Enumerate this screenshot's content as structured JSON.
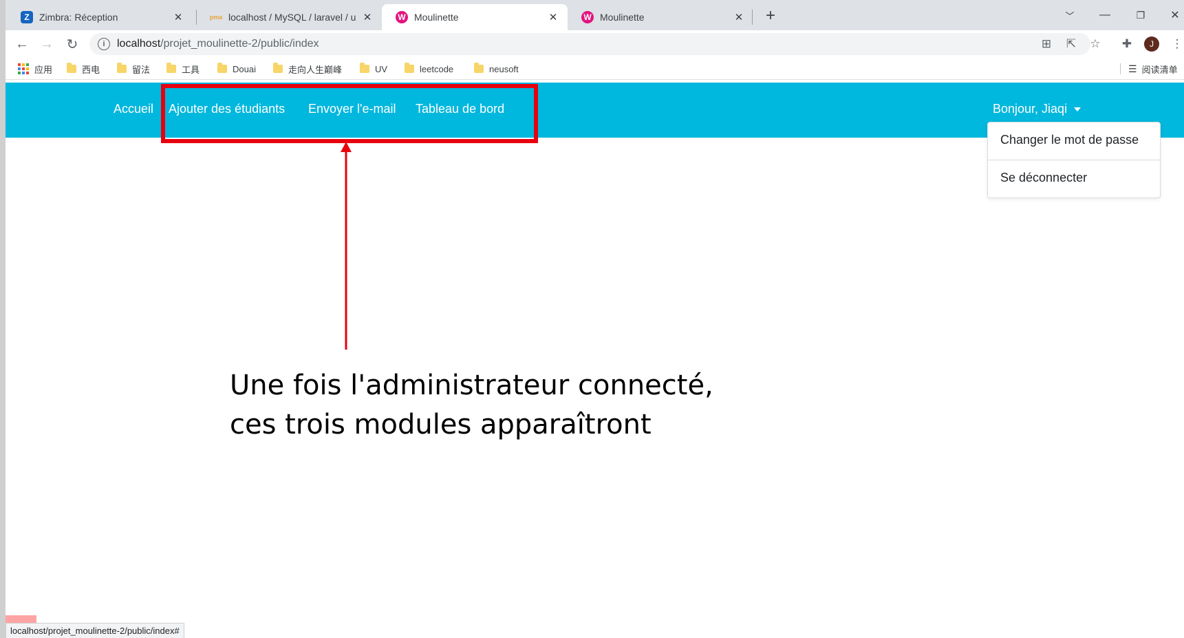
{
  "browser": {
    "tabs": [
      {
        "title": "Zimbra: Réception",
        "favicon_letter": "Z",
        "favicon_color": "#1565c0"
      },
      {
        "title": "localhost / MySQL / laravel / u",
        "favicon_letter": "pma",
        "favicon_color": "#e8a33d"
      },
      {
        "title": "Moulinette",
        "favicon_letter": "W",
        "favicon_color": "#e3137f",
        "active": true
      },
      {
        "title": "Moulinette",
        "favicon_letter": "W",
        "favicon_color": "#e3137f"
      }
    ],
    "url_host": "localhost",
    "url_path": "/projet_moulinette-2/public/index",
    "avatar_letter": "J",
    "bookmarks": [
      "应用",
      "西电",
      "留法",
      "工具",
      "Douai",
      "走向人生巅峰",
      "UV",
      "leetcode",
      "neusoft"
    ],
    "reading_list": "阅读清单",
    "status_url": "localhost/projet_moulinette-2/public/index#"
  },
  "navbar": {
    "links": [
      "Accueil",
      "Ajouter des étudiants",
      "Envoyer l'e-mail",
      "Tableau de bord"
    ],
    "user_greeting": "Bonjour, Jiaqi",
    "dropdown": [
      "Changer le mot de passe",
      "Se déconnecter"
    ]
  },
  "annotation": {
    "line1": "Une fois l'administrateur connecté,",
    "line2": "ces trois modules apparaîtront"
  },
  "colors": {
    "navbar": "#00b7dd",
    "highlight": "#e8000f",
    "arrow": "#e8000f"
  }
}
